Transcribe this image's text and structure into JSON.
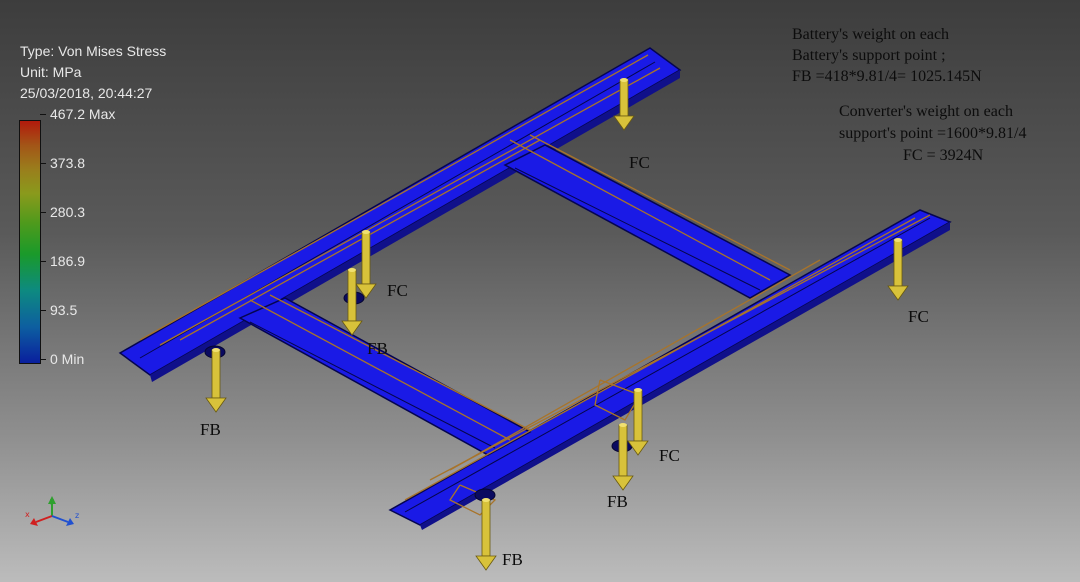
{
  "result_info": {
    "type_line": "Type: Von Mises Stress",
    "unit_line": "Unit: MPa",
    "timestamp": "25/03/2018, 20:44:27"
  },
  "legend": {
    "labels": [
      "467.2 Max",
      "373.8",
      "280.3",
      "186.9",
      "93.5",
      "0 Min"
    ]
  },
  "notes": {
    "battery": [
      "Battery's weight on each",
      "Battery's support point ;",
      " FB =418*9.81/4= 1025.145N"
    ],
    "converter": [
      "Converter's weight on each",
      "support's point =1600*9.81/4",
      "FC =   3924N"
    ]
  },
  "force_labels": [
    "FC",
    "FC",
    "FC",
    "FC",
    "FB",
    "FB",
    "FB",
    "FB"
  ],
  "triad": {
    "x": "x",
    "y": "y",
    "z": "z"
  },
  "colors": {
    "frame_blue": "#1a1ae6",
    "wire_brown": "#a8742a",
    "arrow_yellow": "#d8c23a"
  }
}
